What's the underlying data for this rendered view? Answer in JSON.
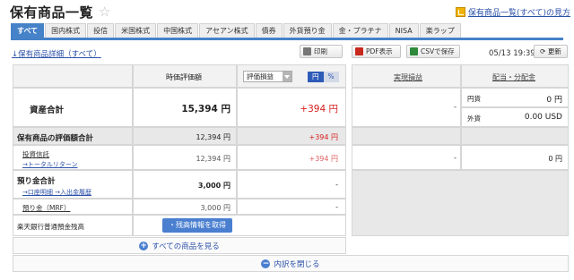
{
  "header": {
    "title": "保有商品一覧",
    "help_link": "保有商品一覧(すべて)の見方"
  },
  "tabs": [
    {
      "label": "すべて",
      "active": true
    },
    {
      "label": "国内株式"
    },
    {
      "label": "投信"
    },
    {
      "label": "米国株式"
    },
    {
      "label": "中国株式"
    },
    {
      "label": "アセアン株式"
    },
    {
      "label": "債券"
    },
    {
      "label": "外貨預り金"
    },
    {
      "label": "金・プラチナ"
    },
    {
      "label": "NISA"
    },
    {
      "label": "楽ラップ"
    }
  ],
  "toolbar": {
    "detail_link": "↓保有商品詳細（すべて）",
    "print_label": "印刷",
    "pdf_label": "PDF表示",
    "csv_label": "CSVで保存",
    "date": "05/13 19:39",
    "refresh_label": "更新"
  },
  "columns": {
    "valuation": "時価評価額",
    "gain_select": "評価損益",
    "toggle_yen": "円",
    "toggle_pct": "%",
    "realized": "実現損益",
    "dividends": "配当・分配金"
  },
  "summary": {
    "label": "資産合計",
    "value": "15,394 円",
    "gain": "+394 円",
    "realized": "-",
    "div_jpy_label": "円貨",
    "div_jpy": "0 円",
    "div_fx_label": "外貨",
    "div_fx": "0.00 USD"
  },
  "holdings": {
    "label": "保有商品の評価額合計",
    "value": "12,394 円",
    "gain": "+394 円",
    "fund_label": "投資信託",
    "fund_sub": "→トータルリターン",
    "fund_value": "12,394 円",
    "fund_gain": "+394 円",
    "fund_realized": "-",
    "fund_div": "0 円"
  },
  "deposits": {
    "label": "預り金合計",
    "links": "→口座明細 →入出金履歴",
    "value": "3,000 円",
    "gain": "-",
    "mrf_label": "預り金（MRF）",
    "mrf_value": "3,000 円",
    "mrf_gain": "-"
  },
  "bank": {
    "label": "楽天銀行普通預金残高",
    "button": "・残高情報を取得"
  },
  "actions": {
    "show_all": "すべての商品を見る",
    "close": "内訳を閉じる"
  }
}
